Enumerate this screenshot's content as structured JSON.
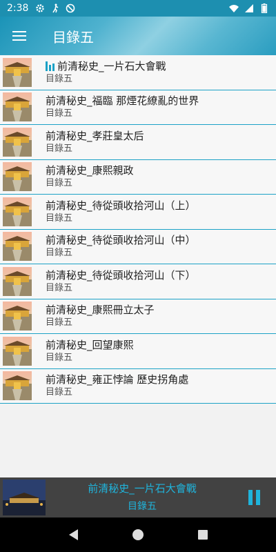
{
  "status_bar": {
    "time": "2:38"
  },
  "app_bar": {
    "title": "目錄五"
  },
  "list": {
    "items": [
      {
        "title": "前清秘史_一片石大會戰",
        "subtitle": "目錄五",
        "playing": true
      },
      {
        "title": "前清秘史_福臨 那煙花繚亂的世界",
        "subtitle": "目錄五",
        "playing": false
      },
      {
        "title": "前清秘史_孝莊皇太后",
        "subtitle": "目錄五",
        "playing": false
      },
      {
        "title": "前清秘史_康熙親政",
        "subtitle": "目錄五",
        "playing": false
      },
      {
        "title": "前清秘史_待從頭收拾河山（上）",
        "subtitle": "目錄五",
        "playing": false
      },
      {
        "title": "前清秘史_待從頭收拾河山（中）",
        "subtitle": "目錄五",
        "playing": false
      },
      {
        "title": "前清秘史_待從頭收拾河山（下）",
        "subtitle": "目錄五",
        "playing": false
      },
      {
        "title": "前清秘史_康熙冊立太子",
        "subtitle": "目錄五",
        "playing": false
      },
      {
        "title": "前清秘史_回望康熙",
        "subtitle": "目錄五",
        "playing": false
      },
      {
        "title": "前清秘史_雍正悖論 歷史拐角處",
        "subtitle": "目錄五",
        "playing": false
      }
    ]
  },
  "player": {
    "title": "前清秘史_一片石大會戰",
    "subtitle": "目錄五"
  },
  "colors": {
    "accent": "#1aa1c6",
    "player_bg": "#424242",
    "player_text": "#1fb4dc"
  },
  "icons": {
    "status": [
      "settings-icon",
      "accessibility-icon",
      "blocked-icon",
      "wifi-icon",
      "signal-icon",
      "battery-icon"
    ],
    "app_bar": "menu-icon",
    "playing_indicator": "equalizer-icon",
    "player_control": "pause-icon",
    "nav": [
      "back-icon",
      "home-icon",
      "recents-icon"
    ]
  }
}
